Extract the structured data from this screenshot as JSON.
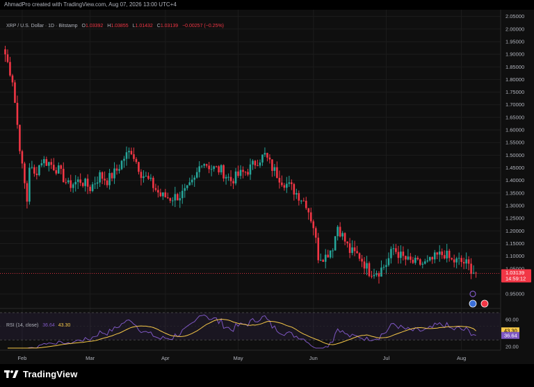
{
  "header": {
    "credit": "AhmadPro created with TradingView.com, Aug 07, 2026 13:00 UTC+4"
  },
  "legend": {
    "symbol": "XRP / U.S. Dollar · 1D · Bitstamp",
    "open_label": "O",
    "open": "1.03392",
    "high_label": "H",
    "high": "1.03855",
    "low_label": "L",
    "low": "1.01432",
    "close_label": "C",
    "close": "1.03139",
    "change": "−0.00257 (−0.25%)"
  },
  "rsi_legend": {
    "name": "RSI (14, close)",
    "rsi_value": "36.64",
    "ma_value": "43.30"
  },
  "footer": {
    "brand": "TradingView"
  },
  "colors": {
    "up": "#26a69a",
    "down": "#f23645",
    "rsi": "#7e57c2",
    "rsi_ma": "#f7c948",
    "background": "#0f0f0f"
  },
  "chart_data": {
    "type": "candlestick",
    "price_axis": {
      "ticks": [
        "2.05000",
        "2.00000",
        "1.95000",
        "1.90000",
        "1.85000",
        "1.80000",
        "1.75000",
        "1.70000",
        "1.65000",
        "1.60000",
        "1.55000",
        "1.50000",
        "1.45000",
        "1.40000",
        "1.35000",
        "1.30000",
        "1.25000",
        "1.20000",
        "1.15000",
        "1.10000",
        "1.05000",
        "0.95000"
      ],
      "range": [
        0.92,
        2.06
      ],
      "last_price_label": "1.03139",
      "countdown_label": "14:59:12"
    },
    "time_axis": {
      "labels": [
        "Feb",
        "Mar",
        "Apr",
        "May",
        "Jun",
        "Jul",
        "Aug"
      ]
    },
    "price_path": [
      [
        "2026-01-25",
        1.9
      ],
      [
        "2026-01-28",
        1.8
      ],
      [
        "2026-01-30",
        1.62
      ],
      [
        "2026-02-01",
        1.45
      ],
      [
        "2026-02-03",
        1.32
      ],
      [
        "2026-02-04",
        1.46
      ],
      [
        "2026-02-06",
        1.42
      ],
      [
        "2026-02-09",
        1.48
      ],
      [
        "2026-02-12",
        1.47
      ],
      [
        "2026-02-16",
        1.44
      ],
      [
        "2026-02-20",
        1.38
      ],
      [
        "2026-02-25",
        1.4
      ],
      [
        "2026-03-01",
        1.37
      ],
      [
        "2026-03-05",
        1.42
      ],
      [
        "2026-03-08",
        1.4
      ],
      [
        "2026-03-12",
        1.44
      ],
      [
        "2026-03-15",
        1.49
      ],
      [
        "2026-03-18",
        1.52
      ],
      [
        "2026-03-22",
        1.43
      ],
      [
        "2026-03-26",
        1.39
      ],
      [
        "2026-03-30",
        1.34
      ],
      [
        "2026-04-03",
        1.33
      ],
      [
        "2026-04-07",
        1.34
      ],
      [
        "2026-04-10",
        1.36
      ],
      [
        "2026-04-13",
        1.4
      ],
      [
        "2026-04-16",
        1.48
      ],
      [
        "2026-04-20",
        1.45
      ],
      [
        "2026-04-24",
        1.44
      ],
      [
        "2026-04-28",
        1.4
      ],
      [
        "2026-05-01",
        1.42
      ],
      [
        "2026-05-05",
        1.44
      ],
      [
        "2026-05-09",
        1.48
      ],
      [
        "2026-05-12",
        1.5
      ],
      [
        "2026-05-15",
        1.45
      ],
      [
        "2026-05-19",
        1.4
      ],
      [
        "2026-05-23",
        1.37
      ],
      [
        "2026-05-26",
        1.34
      ],
      [
        "2026-05-29",
        1.31
      ],
      [
        "2026-06-01",
        1.22
      ],
      [
        "2026-06-03",
        1.1
      ],
      [
        "2026-06-06",
        1.1
      ],
      [
        "2026-06-09",
        1.14
      ],
      [
        "2026-06-11",
        1.22
      ],
      [
        "2026-06-13",
        1.18
      ],
      [
        "2026-06-16",
        1.12
      ],
      [
        "2026-06-20",
        1.1
      ],
      [
        "2026-06-24",
        1.04
      ],
      [
        "2026-06-28",
        1.04
      ],
      [
        "2026-07-01",
        1.07
      ],
      [
        "2026-07-04",
        1.13
      ],
      [
        "2026-07-07",
        1.1
      ],
      [
        "2026-07-10",
        1.08
      ],
      [
        "2026-07-14",
        1.07
      ],
      [
        "2026-07-18",
        1.07
      ],
      [
        "2026-07-22",
        1.1
      ],
      [
        "2026-07-25",
        1.11
      ],
      [
        "2026-07-28",
        1.08
      ],
      [
        "2026-07-31",
        1.08
      ],
      [
        "2026-08-03",
        1.07
      ],
      [
        "2026-08-07",
        1.03
      ]
    ],
    "last": {
      "open": 1.03392,
      "high": 1.03855,
      "low": 1.01432,
      "close": 1.03139
    },
    "rsi": {
      "period": 14,
      "range": [
        15,
        70
      ],
      "ticks": [
        60,
        20
      ],
      "bands": [
        70,
        30
      ],
      "current": 36.64,
      "ma_current": 43.3
    }
  }
}
